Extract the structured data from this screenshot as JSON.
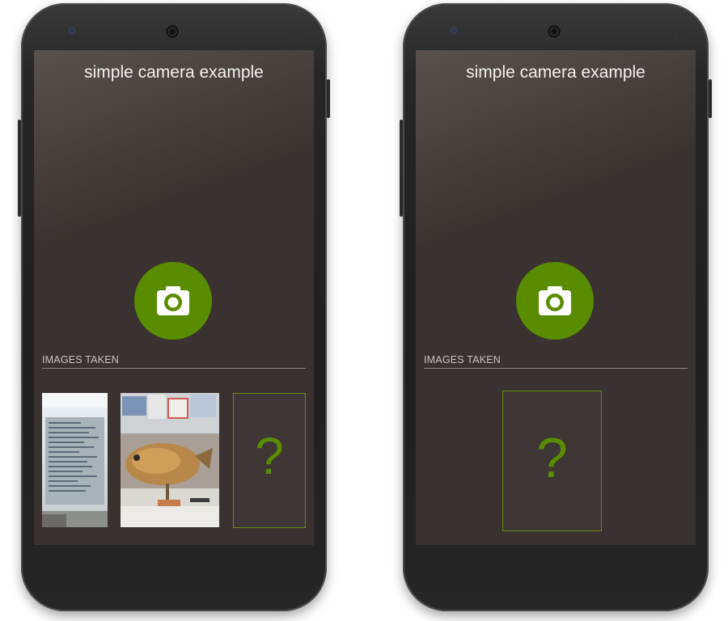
{
  "left_screen": {
    "title": "simple camera example",
    "images_label": "IMAGES TAKEN",
    "placeholder_symbol": "?",
    "thumbnails": [
      "photo-monitor",
      "photo-fish"
    ],
    "accent_color": "#5a8c00"
  },
  "right_screen": {
    "title": "simple camera example",
    "images_label": "IMAGES TAKEN",
    "placeholder_symbol": "?",
    "accent_color": "#5a8c00"
  },
  "icons": {
    "camera_button": "camera-icon"
  }
}
